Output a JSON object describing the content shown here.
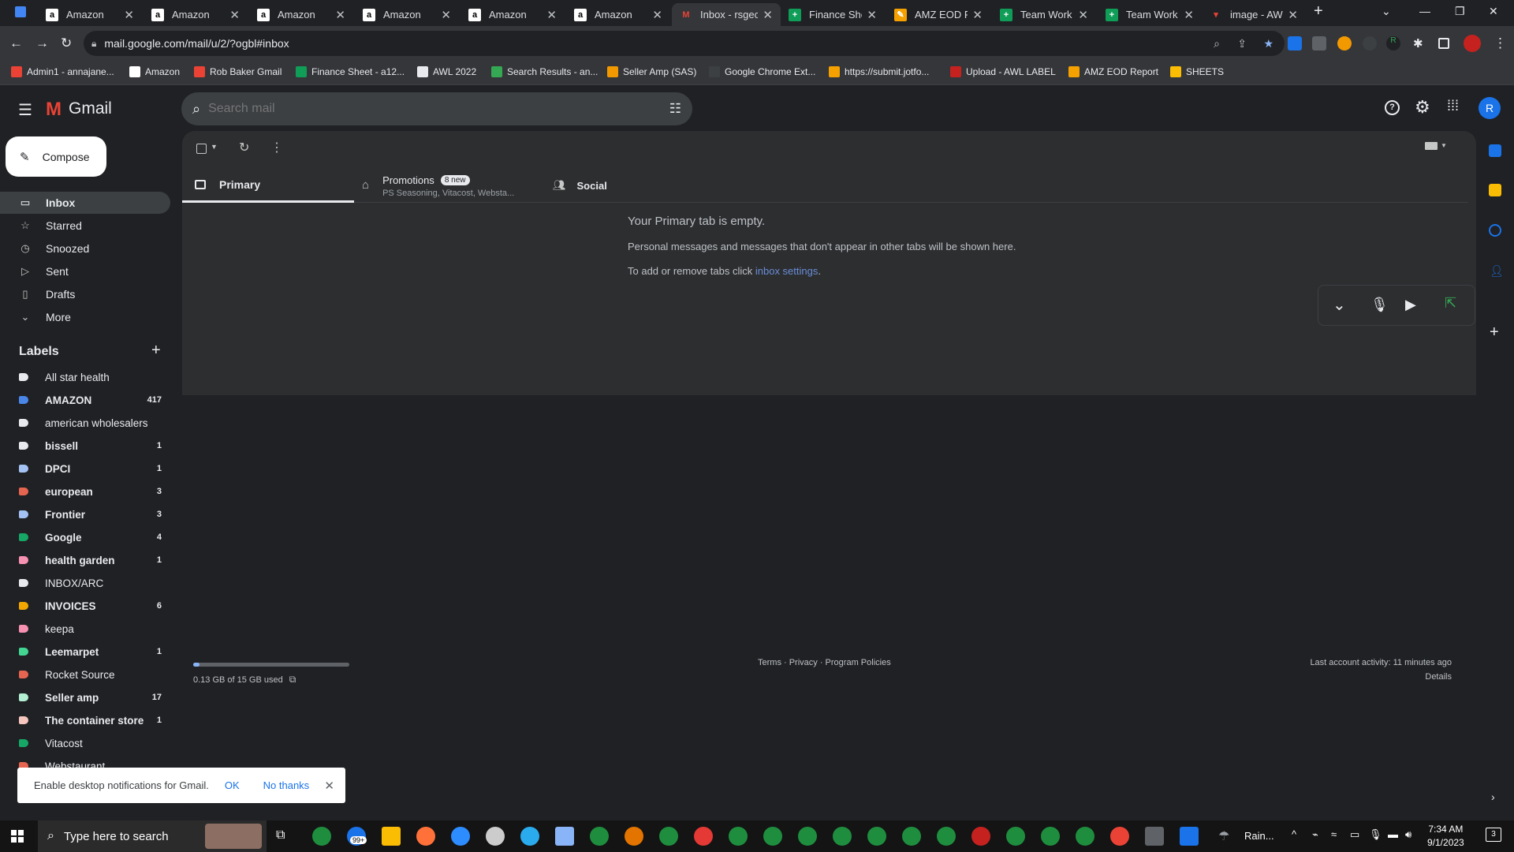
{
  "tabs": [
    {
      "title": "Amazon",
      "icon": "amazon-icon"
    },
    {
      "title": "Amazon",
      "icon": "amazon-icon"
    },
    {
      "title": "Amazon",
      "icon": "amazon-icon"
    },
    {
      "title": "Amazon",
      "icon": "amazon-icon"
    },
    {
      "title": "Amazon",
      "icon": "amazon-icon"
    },
    {
      "title": "Amazon",
      "icon": "amazon-icon"
    },
    {
      "title": "Inbox - rsgec",
      "icon": "gmail-icon"
    },
    {
      "title": "Finance Shee",
      "icon": "sheets-icon"
    },
    {
      "title": "AMZ EOD Re",
      "icon": "amz-eod-icon"
    },
    {
      "title": "Team Work F",
      "icon": "sheets-icon"
    },
    {
      "title": "Team Work F",
      "icon": "sheets-icon"
    },
    {
      "title": "image - AWL",
      "icon": "image-icon"
    }
  ],
  "url": "mail.google.com/mail/u/2/?ogbl#inbox",
  "bookmarks": [
    "Admin1 - annajane...",
    "Amazon",
    "Rob Baker Gmail",
    "Finance Sheet - a12...",
    "AWL 2022",
    "Search Results - an...",
    "Seller Amp (SAS)",
    "Google Chrome Ext...",
    "https://submit.jotfo...",
    "Upload - AWL LABEL",
    "AMZ EOD Report",
    "SHEETS"
  ],
  "gmail": {
    "brand": "Gmail",
    "search_placeholder": "Search mail",
    "avatar_letter": "R",
    "compose": "Compose"
  },
  "nav": [
    {
      "label": "Inbox",
      "icon": "inbox-icon",
      "selected": true
    },
    {
      "label": "Starred",
      "icon": "star-icon"
    },
    {
      "label": "Snoozed",
      "icon": "clock-icon"
    },
    {
      "label": "Sent",
      "icon": "send-icon"
    },
    {
      "label": "Drafts",
      "icon": "draft-icon"
    },
    {
      "label": "More",
      "icon": "chevron-down-icon"
    }
  ],
  "labels_header": "Labels",
  "labels": [
    {
      "name": "All star health",
      "count": "",
      "color": "#e8eaed",
      "bold": false
    },
    {
      "name": "AMAZON",
      "count": "417",
      "color": "#4a86e8",
      "bold": true
    },
    {
      "name": "american wholesalers",
      "count": "",
      "color": "#e8eaed",
      "bold": false
    },
    {
      "name": "bissell",
      "count": "1",
      "color": "#e8eaed",
      "bold": true
    },
    {
      "name": "DPCI",
      "count": "1",
      "color": "#a4c2f4",
      "bold": true
    },
    {
      "name": "european",
      "count": "3",
      "color": "#e66550",
      "bold": true
    },
    {
      "name": "Frontier",
      "count": "3",
      "color": "#a4c2f4",
      "bold": true
    },
    {
      "name": "Google",
      "count": "4",
      "color": "#16a766",
      "bold": true
    },
    {
      "name": "health garden",
      "count": "1",
      "color": "#f691b2",
      "bold": true
    },
    {
      "name": "INBOX/ARC",
      "count": "",
      "color": "#e8eaed",
      "bold": false
    },
    {
      "name": "INVOICES",
      "count": "6",
      "color": "#f2a600",
      "bold": true
    },
    {
      "name": "keepa",
      "count": "",
      "color": "#f691b2",
      "bold": false
    },
    {
      "name": "Leemarpet",
      "count": "1",
      "color": "#43d692",
      "bold": true
    },
    {
      "name": "Rocket Source",
      "count": "",
      "color": "#e66550",
      "bold": false
    },
    {
      "name": "Seller amp",
      "count": "17",
      "color": "#b3efd3",
      "bold": true
    },
    {
      "name": "The container store",
      "count": "1",
      "color": "#f6c5be",
      "bold": true
    },
    {
      "name": "Vitacost",
      "count": "",
      "color": "#16a766",
      "bold": false
    },
    {
      "name": "Webstaurant",
      "count": "",
      "color": "#e66550",
      "bold": false
    }
  ],
  "category_tabs": [
    {
      "label": "Primary",
      "icon": "inbox-icon"
    },
    {
      "label": "Promotions",
      "icon": "tag-icon",
      "badge": "8 new",
      "snippet": "PS Seasoning, Vitacost, Websta..."
    },
    {
      "label": "Social",
      "icon": "people-icon"
    }
  ],
  "empty": {
    "title": "Your Primary tab is empty.",
    "line1": "Personal messages and messages that don't appear in other tabs will be shown here.",
    "line2_prefix": "To add or remove tabs click ",
    "line2_link": "inbox settings",
    "line2_suffix": "."
  },
  "footer": {
    "storage": "0.13 GB of 15 GB used",
    "storage_fraction": 0.0087,
    "links": "Terms · Privacy · Program Policies",
    "activity": "Last account activity: 11 minutes ago",
    "details": "Details"
  },
  "notification": {
    "text": "Enable desktop notifications for Gmail.",
    "ok": "OK",
    "no": "No thanks"
  },
  "taskbar": {
    "search_placeholder": "Type here to search",
    "weather": "Rain...",
    "time": "7:34 AM",
    "date": "9/1/2023",
    "mail_badge": "99+",
    "notif_count": "3"
  }
}
